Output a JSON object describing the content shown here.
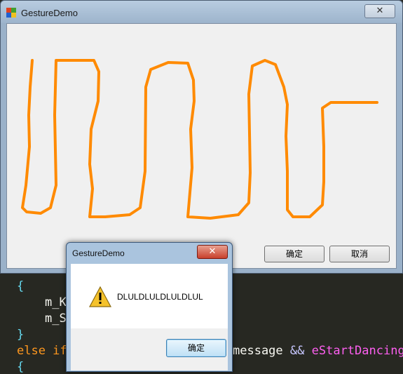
{
  "main_window": {
    "title": "GestureDemo",
    "close_symbol": "✕",
    "ok_label": "确定",
    "cancel_label": "取消",
    "gesture_color": "#ff8a00"
  },
  "dialog": {
    "title": "GestureDemo",
    "close_symbol": "✕",
    "icon": "warning-icon",
    "message": "DLULDLULDLULDLUL",
    "ok_label": "确定"
  },
  "code_editor": {
    "lines": [
      "{",
      "m_K",
      "m_S",
      "}",
      "else if",
      "message && eStartDancing",
      "{"
    ]
  },
  "colors": {
    "code_background": "#272822",
    "code_keyword": "#f92672",
    "code_identifier": "#fd5ff0"
  }
}
